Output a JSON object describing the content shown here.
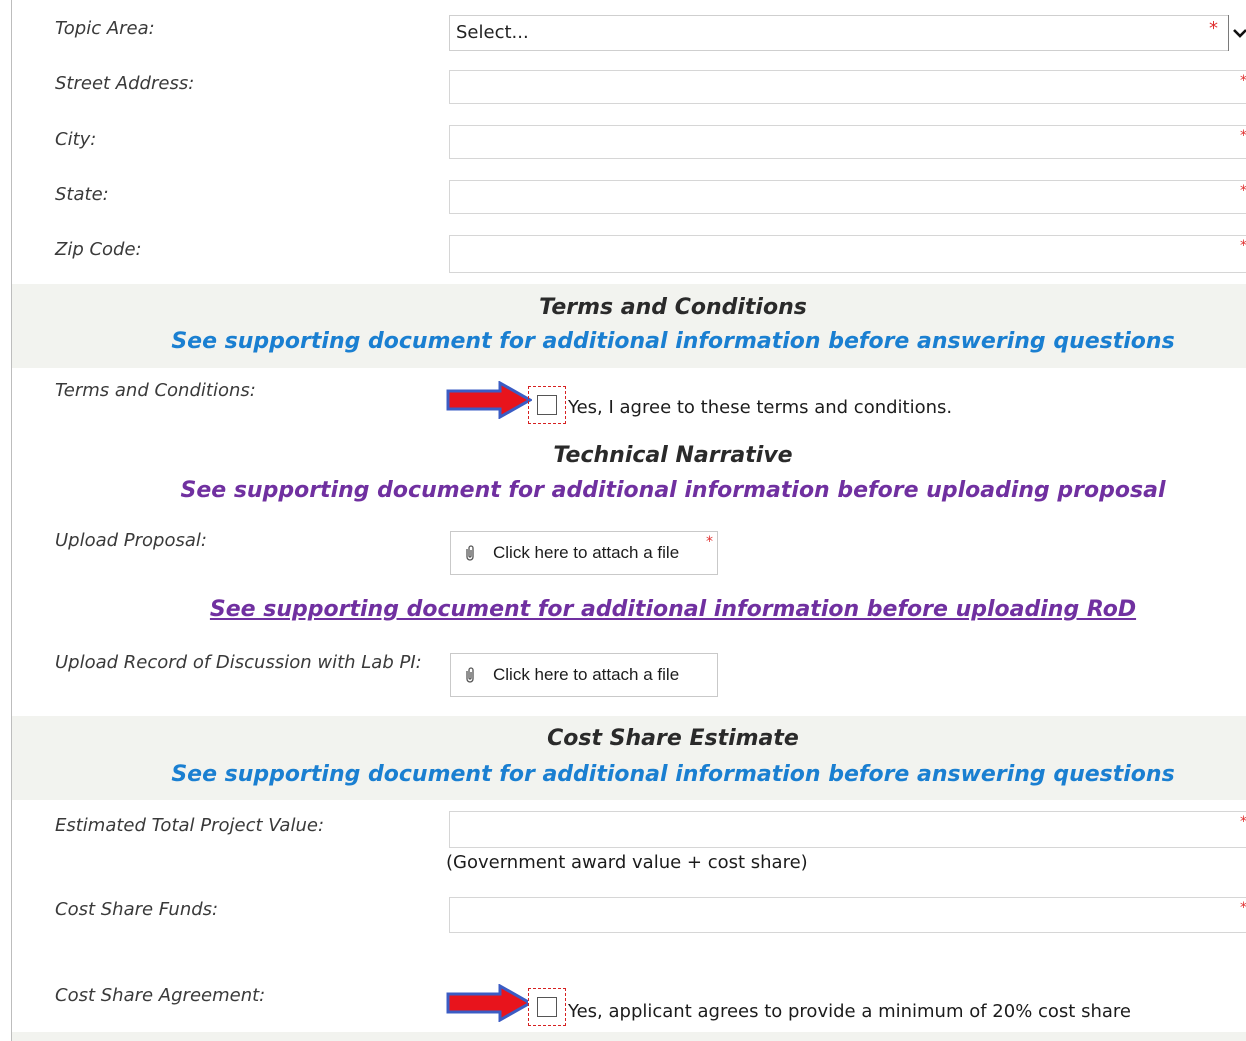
{
  "location": {
    "topic_area": {
      "label": "Topic Area:",
      "selected": "Select...",
      "required_mark": "*"
    },
    "street_address": {
      "label": "Street Address:",
      "value": "",
      "required_mark": "*"
    },
    "city": {
      "label": "City:",
      "value": "",
      "required_mark": "*"
    },
    "state": {
      "label": "State:",
      "value": "",
      "required_mark": "*"
    },
    "zip_code": {
      "label": "Zip Code:",
      "value": "",
      "required_mark": "*"
    }
  },
  "terms": {
    "heading": "Terms and Conditions",
    "note": "See supporting document for additional information before answering questions",
    "field_label": "Terms and Conditions:",
    "checkbox_label": "Yes, I agree to these terms and conditions.",
    "checked": false
  },
  "technical": {
    "heading": "Technical Narrative",
    "note": "See supporting document for additional information before uploading proposal",
    "upload_proposal": {
      "label": "Upload Proposal:",
      "button": "Click here to attach a file",
      "required_mark": "*"
    },
    "rod_link": "See supporting document for additional information before uploading RoD",
    "upload_rod": {
      "label": "Upload Record of Discussion with Lab PI:",
      "button": "Click here to attach a file"
    }
  },
  "cost_share": {
    "heading": "Cost Share Estimate",
    "note": "See supporting document for additional information before answering questions",
    "total_value": {
      "label": "Estimated Total Project Value:",
      "value": "",
      "required_mark": "*",
      "helper": "(Government award value + cost share)"
    },
    "funds": {
      "label": "Cost Share Funds:",
      "value": "",
      "required_mark": "*"
    },
    "agreement": {
      "label": "Cost Share Agreement:",
      "checkbox_label": "Yes, applicant agrees to provide a minimum of 20% cost share",
      "checked": false
    }
  },
  "colors": {
    "required": "#e03030",
    "note_blue": "#1a7fd1",
    "note_purple": "#7030a0",
    "arrow_fill": "#e8141c",
    "arrow_outline": "#3b5cc4",
    "band": "#f2f3ef"
  },
  "icons": {
    "attach": "paperclip-icon",
    "dropdown": "chevron-down-icon",
    "pointer": "right-arrow-icon"
  }
}
